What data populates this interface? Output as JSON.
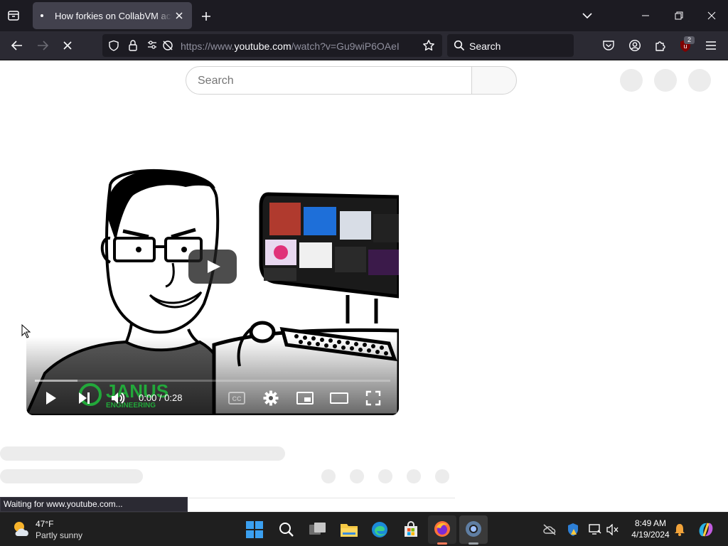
{
  "browser": {
    "tab_title": "How forkies on CollabVM act when",
    "url_prefix": "https://www.",
    "url_domain": "youtube.com",
    "url_path": "/watch?v=Gu9wiP6OAeI",
    "search_placeholder": "Search",
    "extension_badge": "2",
    "status_text": "Waiting for www.youtube.com..."
  },
  "youtube": {
    "search_placeholder": "Search",
    "player": {
      "time_display": "0:00 / 0:28",
      "watermark": "JANUS",
      "watermark_sub": "ENGINEERING",
      "loaded_fraction": 0.12
    }
  },
  "taskbar": {
    "weather_temp": "47°F",
    "weather_desc": "Partly sunny",
    "time": "8:49 AM",
    "date": "4/19/2024"
  },
  "colors": {
    "chrome_dark": "#1c1b22",
    "chrome_mid": "#2b2a33",
    "tab_active": "#42414d",
    "skeleton": "#ececec",
    "taskbar": "#1f1f1f"
  },
  "icons": [
    "tab-list-icon",
    "close-icon",
    "new-tab-icon",
    "chevron-down-icon",
    "minimize-icon",
    "restore-icon",
    "back-icon",
    "forward-icon",
    "stop-icon",
    "shield-icon",
    "lock-icon",
    "permissions-icon",
    "bookmark-star-icon",
    "search-icon",
    "pocket-icon",
    "account-icon",
    "extensions-icon",
    "ublock-icon",
    "menu-icon",
    "play-icon",
    "next-icon",
    "volume-icon",
    "cc-icon",
    "settings-icon",
    "miniplayer-icon",
    "theater-icon",
    "fullscreen-icon",
    "weather-icon",
    "start-icon",
    "task-view-icon",
    "file-explorer-icon",
    "edge-icon",
    "store-icon",
    "firefox-icon",
    "chrome-icon",
    "cloud-off-icon",
    "defender-icon",
    "display-icon",
    "volume-muted-icon",
    "bell-icon",
    "copilot-icon"
  ]
}
